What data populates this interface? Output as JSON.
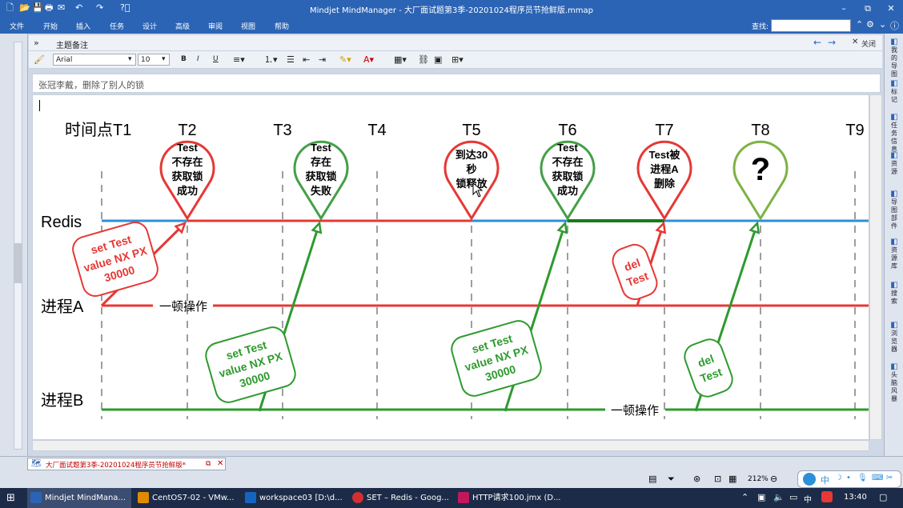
{
  "window": {
    "title": "Mindjet MindManager - 大厂面试题第3季-20201024程序员节抢鲜版.mmap"
  },
  "window_controls": {
    "minimize": "–",
    "restore": "⧉",
    "close": "✕"
  },
  "menu": [
    "文件",
    "开始",
    "插入",
    "任务",
    "设计",
    "高级",
    "审阅",
    "视图",
    "帮助"
  ],
  "search": {
    "label": "查找:"
  },
  "notes_panel": {
    "title": "主题备注",
    "nav_back": "←",
    "nav_forward": "→",
    "close_label": "关闭"
  },
  "format_toolbar": {
    "font": "Arial",
    "size": "10",
    "bold": "B",
    "italic": "I",
    "underline": "U"
  },
  "notes": {
    "text": "张冠李戴，删除了别人的锁"
  },
  "diagram": {
    "header_first": "时间点T1",
    "time_labels": [
      "T2",
      "T3",
      "T4",
      "T5",
      "T6",
      "T7",
      "T8",
      "T9"
    ],
    "lanes": {
      "redis": "Redis",
      "a": "进程A",
      "b": "进程B"
    },
    "pins": [
      {
        "lines": [
          "Test",
          "不存在",
          "获取锁",
          "成功"
        ],
        "color": "#e53935"
      },
      {
        "lines": [
          "Test",
          "存在",
          "获取锁",
          "失败"
        ],
        "color": "#43a047"
      },
      {
        "lines": [
          "到达30",
          "秒",
          "锁释放"
        ],
        "color": "#e53935"
      },
      {
        "lines": [
          "Test",
          "不存在",
          "获取锁",
          "成功"
        ],
        "color": "#43a047"
      },
      {
        "lines": [
          "Test被",
          "进程A",
          "删除"
        ],
        "color": "#e53935"
      },
      {
        "lines": [
          "?"
        ],
        "color": "#7cb342"
      }
    ],
    "cmd_a_set": [
      "set  Test",
      "value NX  PX",
      "30000"
    ],
    "cmd_b_set1": [
      "set  Test",
      "value NX  PX",
      "30000"
    ],
    "cmd_b_set2": [
      "set  Test",
      "value NX  PX",
      "30000"
    ],
    "cmd_a_del": [
      "del",
      "Test"
    ],
    "cmd_b_del": [
      "del",
      "Test"
    ],
    "op_a": "一顿操作",
    "op_b": "一顿操作",
    "colors": {
      "red": "#e53935",
      "green": "#2e9a2e",
      "blue": "#2d8fd8"
    }
  },
  "right_panel": [
    "我的导图",
    "标记",
    "任务信息",
    "资源",
    "导图部件",
    "资源库",
    "搜索",
    "浏览器",
    "头脑风暴"
  ],
  "doc_tab": {
    "label": "大厂面试题第3季-20201024程序员节抢鲜版*"
  },
  "status": {
    "zoom": "212%"
  },
  "ime": {
    "label": "中"
  },
  "taskbar": {
    "items": [
      "Mindjet MindMana...",
      "CentOS7-02 - VMw...",
      "workspace03 [D:\\d...",
      "SET – Redis - Goog...",
      "HTTP请求100.jmx (D..."
    ],
    "tray_lang": "中",
    "clock": "13:40"
  }
}
